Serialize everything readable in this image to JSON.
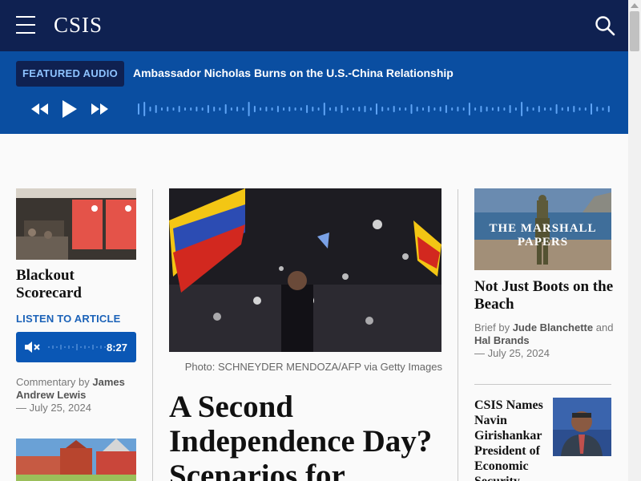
{
  "header": {
    "logo": "CSIS",
    "menu_icon": "hamburger-menu-icon",
    "search_icon": "search-icon",
    "bg_color": "#0f2151"
  },
  "featured_audio": {
    "badge": "FEATURED AUDIO",
    "title": "Ambassador Nicholas Burns on the U.S.-China Relationship",
    "controls": [
      "rewind-icon",
      "play-icon",
      "fast-forward-icon"
    ],
    "bg_color": "#0a4ea1"
  },
  "left_column": {
    "article1": {
      "title": "Blackout Scorecard",
      "listen_label": "LISTEN TO ARTICLE",
      "player_duration": "8:27",
      "mute_icon": "mute-icon",
      "meta_type": "Commentary by",
      "author": "James Andrew Lewis",
      "date": "— July 25, 2024"
    }
  },
  "center_column": {
    "photo_caption": "Photo: SCHNEYDER MENDOZA/AFP via Getty Images",
    "headline": "A Second Independence Day? Scenarios for"
  },
  "right_column": {
    "article1": {
      "image_text": "THE MARSHALL PAPERS",
      "title": "Not Just Boots on the Beach",
      "meta_type": "Brief by",
      "author1": "Jude Blanchette",
      "and": "and",
      "author2": "Hal Brands",
      "date": "— July 25, 2024"
    },
    "article2": {
      "title": "CSIS Names Navin Girishankar President of Economic Security"
    }
  }
}
